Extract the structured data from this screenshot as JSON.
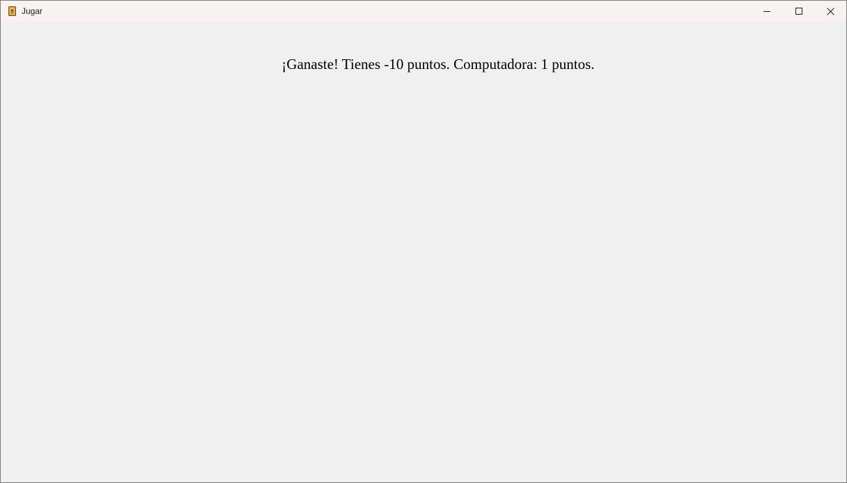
{
  "window": {
    "title": "Jugar",
    "icon": "app-book-icon",
    "controls": {
      "minimize": "minimize-icon",
      "maximize": "maximize-icon",
      "close": "close-icon"
    }
  },
  "game": {
    "result_message": "¡Ganaste! Tienes -10 puntos. Computadora: 1 puntos."
  },
  "colors": {
    "titlebar_bg": "#f8f3f1",
    "client_bg": "#f0f0f0",
    "text": "#000000"
  }
}
